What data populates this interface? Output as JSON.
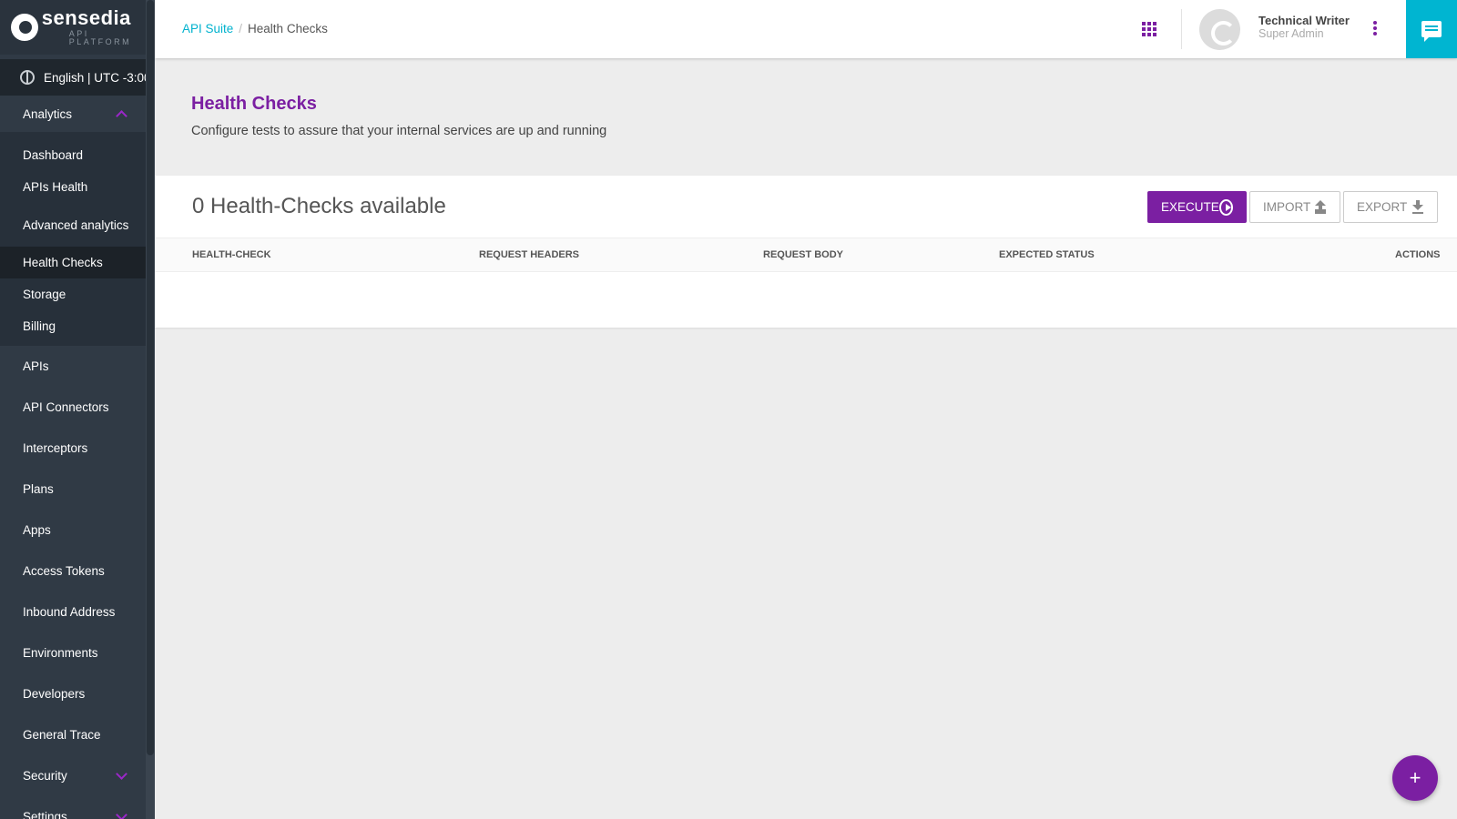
{
  "brand": {
    "name": "sensedia",
    "sub": "API PLATFORM"
  },
  "locale": {
    "label": "English | UTC -3:00"
  },
  "sidebar": {
    "analytics": {
      "label": "Analytics",
      "items": [
        {
          "label": "Dashboard"
        },
        {
          "label": "APIs Health"
        },
        {
          "label": "Advanced analytics"
        },
        {
          "label": "Health Checks"
        },
        {
          "label": "Storage"
        },
        {
          "label": "Billing"
        }
      ]
    },
    "items": [
      {
        "label": "APIs"
      },
      {
        "label": "API Connectors"
      },
      {
        "label": "Interceptors"
      },
      {
        "label": "Plans"
      },
      {
        "label": "Apps"
      },
      {
        "label": "Access Tokens"
      },
      {
        "label": "Inbound Address"
      },
      {
        "label": "Environments"
      },
      {
        "label": "Developers"
      },
      {
        "label": "General Trace"
      },
      {
        "label": "Security"
      },
      {
        "label": "Settings"
      }
    ]
  },
  "breadcrumb": {
    "root": "API Suite",
    "separator": "/",
    "current": "Health Checks"
  },
  "user": {
    "name": "Technical Writer",
    "role": "Super Admin"
  },
  "page": {
    "title": "Health Checks",
    "subtitle": "Configure tests to assure that your internal services are up and running"
  },
  "card": {
    "title": "0 Health-Checks available",
    "buttons": {
      "execute": "EXECUTE",
      "import": "IMPORT",
      "export": "EXPORT"
    },
    "columns": [
      "HEALTH-CHECK",
      "REQUEST HEADERS",
      "REQUEST BODY",
      "EXPECTED STATUS",
      "ACTIONS"
    ],
    "rows": []
  },
  "fab": {
    "label": "+"
  },
  "colors": {
    "accent": "#7b1fa2",
    "link": "#00b2ce",
    "sidebar": "#303a45",
    "chat": "#00b5d1"
  }
}
